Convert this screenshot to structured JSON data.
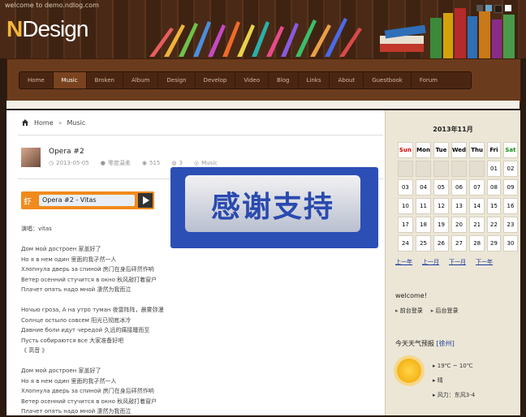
{
  "header": {
    "welcome": "welcome to demo.ndlog.com",
    "logo_n": "N",
    "logo_rest": "Design"
  },
  "nav": {
    "items": [
      "Home",
      "Music",
      "Broken",
      "Album",
      "Design",
      "Develop",
      "Video",
      "Blog",
      "Links",
      "About",
      "Guestbook",
      "Forum"
    ],
    "active": "Music"
  },
  "breadcrumb": {
    "home": "Home",
    "sep": "»",
    "current": "Music"
  },
  "post": {
    "title": "Opera #2",
    "date": "2013-05-05",
    "author": "零度温柔",
    "views": "515",
    "comments": "3",
    "category": "Music"
  },
  "player": {
    "icon": "虾",
    "track": "Opera #2 - Vitas"
  },
  "lyrics": [
    "演唱：vitas",
    "",
    "Дом мой достроен 家盖好了",
    "Но я в нем один 里面的我孑然一人",
    "Хлопнула дверь за спиной 房门在身后砰然作响",
    "Ветер осенний стучится в окно 秋风敲打着窗户",
    "Плачет опять надо мной 凄然为我而泣",
    "",
    "Ночью гроза, А на утро туман 夜雷阵阵，晨雾弥漫",
    "Солнце остыло совсем 阳光已彻底冰冷",
    "Давние боли идут чередой 久远的痛接踵而至",
    "Пусть собираются все 大家准备好吧",
    "《 高音 》",
    "",
    "Дом мой достроен 家盖好了",
    "Но я в нем один 里面的我孑然一人",
    "Хлопнула дверь за спиной 房门在身后砰然作响",
    "Ветер осенний стучится в окно 秋风敲打着窗户",
    "Плачет опять надо мной 凄然为我而泣"
  ],
  "overlay": {
    "text": "感谢支持"
  },
  "calendar": {
    "title": "2013年11月",
    "weekdays": [
      "Sun",
      "Mon",
      "Tue",
      "Wed",
      "Thu",
      "Fri",
      "Sat"
    ],
    "weeks": [
      [
        "",
        "",
        "",
        "",
        "",
        "01",
        "02"
      ],
      [
        "03",
        "04",
        "05",
        "06",
        "07",
        "08",
        "09"
      ],
      [
        "10",
        "11",
        "12",
        "13",
        "14",
        "15",
        "16"
      ],
      [
        "17",
        "18",
        "19",
        "20",
        "21",
        "22",
        "23"
      ],
      [
        "24",
        "25",
        "26",
        "27",
        "28",
        "29",
        "30"
      ]
    ],
    "nav": [
      "上一年",
      "上一月",
      "下一月",
      "下一年"
    ],
    "colors": {
      "sun": "#d40000",
      "sat": "#138a13"
    }
  },
  "welcome_widget": {
    "title": "welcome!",
    "links": [
      "前台登录",
      "后台登录"
    ]
  },
  "weather": {
    "title": "今天天气预报",
    "city": "[徐州]",
    "items": [
      "19℃ ~ 10℃",
      "晴",
      "风力：东风3-4"
    ]
  }
}
